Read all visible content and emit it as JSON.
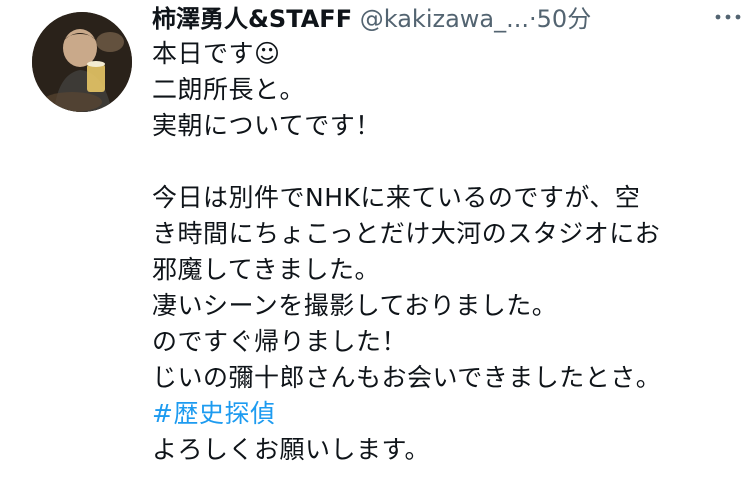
{
  "tweet": {
    "author": {
      "display_name": "柿澤勇人&STAFF",
      "handle": "@kakizawa_...",
      "separator": "·",
      "time": "50分"
    },
    "more_icon": "more-horizontal-icon",
    "lines": {
      "l1": "本日です☺︎",
      "l2": "二朗所長と。",
      "l3": "実朝についてです！",
      "l4": "今日は別件でNHKに来ているのですが、空",
      "l5": "き時間にちょこっとだけ大河のスタジオにお",
      "l6": "邪魔してきました。",
      "l7": "凄いシーンを撮影しておりました。",
      "l8": "のですぐ帰りました！",
      "l9": "じいの彌十郎さんもお会いできましたとさ。",
      "hashtag": "#歴史探偵",
      "l11": "よろしくお願いします。"
    },
    "colors": {
      "text": "#0f1419",
      "secondary": "#536471",
      "link": "#1d9bf0"
    }
  }
}
